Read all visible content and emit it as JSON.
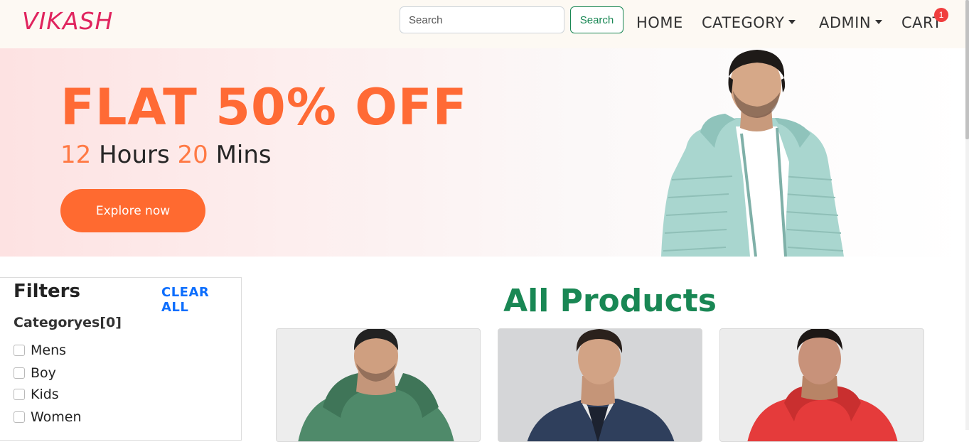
{
  "brand": "VIKASH",
  "search": {
    "placeholder": "Search",
    "button_label": "Search"
  },
  "nav": {
    "home": "HOME",
    "category": "CATEGORY",
    "admin": "ADMIN",
    "cart": "CART",
    "cart_count": "1"
  },
  "hero": {
    "title": "FLAT 50% OFF",
    "hours": "12",
    "hours_label": "Hours",
    "mins": "20",
    "mins_label": "Mins",
    "button_label": "Explore now"
  },
  "filters": {
    "title": "Filters",
    "clear_all": "CLEAR ALL",
    "category_heading": "Categoryes[0]",
    "categories": [
      "Mens",
      "Boy",
      "Kids",
      "Women"
    ]
  },
  "products": {
    "title": "All Products"
  },
  "colors": {
    "brand": "#e0245e",
    "accent": "#ff6a35",
    "success": "#198754",
    "link": "#0d6efd",
    "badge": "#f03e3e"
  }
}
